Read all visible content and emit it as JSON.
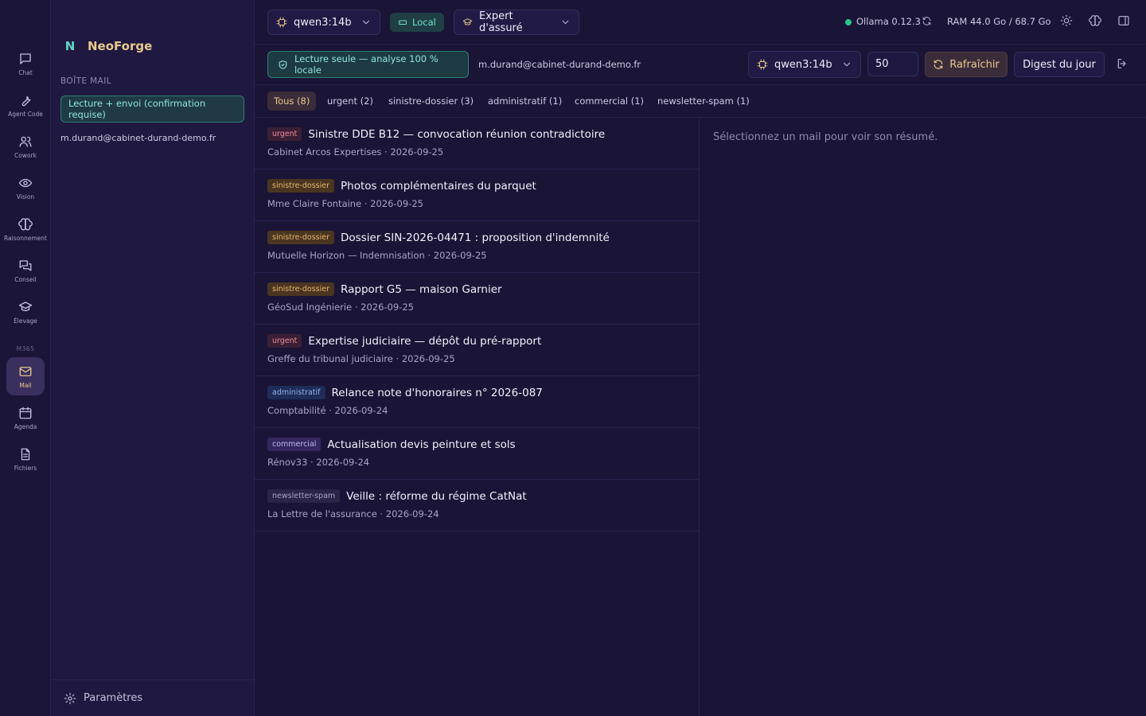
{
  "rail": {
    "items": [
      {
        "label": "Chat",
        "icon": "chat-icon"
      },
      {
        "label": "Agent Code",
        "icon": "wrench-icon"
      },
      {
        "label": "Cowork",
        "icon": "users-icon"
      },
      {
        "label": "Vision",
        "icon": "eye-icon"
      },
      {
        "label": "Raisonnement",
        "icon": "brain-icon"
      },
      {
        "label": "Conseil",
        "icon": "messages-icon"
      },
      {
        "label": "Élevage",
        "icon": "graduation-cap-icon"
      },
      {
        "label": "Mail",
        "icon": "mail-icon",
        "active": true
      },
      {
        "label": "Agenda",
        "icon": "calendar-icon"
      },
      {
        "label": "Fichiers",
        "icon": "file-icon"
      }
    ],
    "section_label": "M365"
  },
  "sidebar": {
    "brand_letter": "N",
    "brand_name": "NeoForge",
    "section_title": "BOÎTE MAIL",
    "mode": "Lecture + envoi (confirmation requise)",
    "account": "m.durand@cabinet-durand-demo.fr",
    "settings_label": "Paramètres"
  },
  "topbar": {
    "model": "qwen3:14b",
    "local_badge": "Local",
    "persona": "Expert d'assuré",
    "ollama_version": "Ollama 0.12.3",
    "ram": "RAM 44.0 Go / 68.7 Go",
    "status_color": "#2ec48a"
  },
  "toolbar": {
    "readonly_badge": "Lecture seule — analyse 100 % locale",
    "account": "m.durand@cabinet-durand-demo.fr",
    "model": "qwen3:14b",
    "count": "50",
    "refresh_label": "Rafraîchir",
    "digest_label": "Digest du jour"
  },
  "filters": [
    {
      "label": "Tous (8)",
      "active": true
    },
    {
      "label": "urgent (2)"
    },
    {
      "label": "sinistre-dossier (3)"
    },
    {
      "label": "administratif (1)"
    },
    {
      "label": "commercial (1)"
    },
    {
      "label": "newsletter-spam (1)"
    }
  ],
  "mails": [
    {
      "tag": "urgent",
      "subject": "Sinistre DDE B12 — convocation réunion contradictoire",
      "meta": "Cabinet Arcos Expertises · 2026-09-25"
    },
    {
      "tag": "sinistre-dossier",
      "subject": "Photos complémentaires du parquet",
      "meta": "Mme Claire Fontaine · 2026-09-25"
    },
    {
      "tag": "sinistre-dossier",
      "subject": "Dossier SIN-2026-04471 : proposition d'indemnité",
      "meta": "Mutuelle Horizon — Indemnisation · 2026-09-25"
    },
    {
      "tag": "sinistre-dossier",
      "subject": "Rapport G5 — maison Garnier",
      "meta": "GéoSud Ingénierie · 2026-09-25"
    },
    {
      "tag": "urgent",
      "subject": "Expertise judiciaire — dépôt du pré-rapport",
      "meta": "Greffe du tribunal judiciaire · 2026-09-25"
    },
    {
      "tag": "administratif",
      "subject": "Relance note d'honoraires n° 2026-087",
      "meta": "Comptabilité · 2026-09-24"
    },
    {
      "tag": "commercial",
      "subject": "Actualisation devis peinture et sols",
      "meta": "Rénov33 · 2026-09-24"
    },
    {
      "tag": "newsletter-spam",
      "subject": "Veille : réforme du régime CatNat",
      "meta": "La Lettre de l'assurance · 2026-09-24"
    }
  ],
  "preview": {
    "empty_text": "Sélectionnez un mail pour voir son résumé."
  }
}
